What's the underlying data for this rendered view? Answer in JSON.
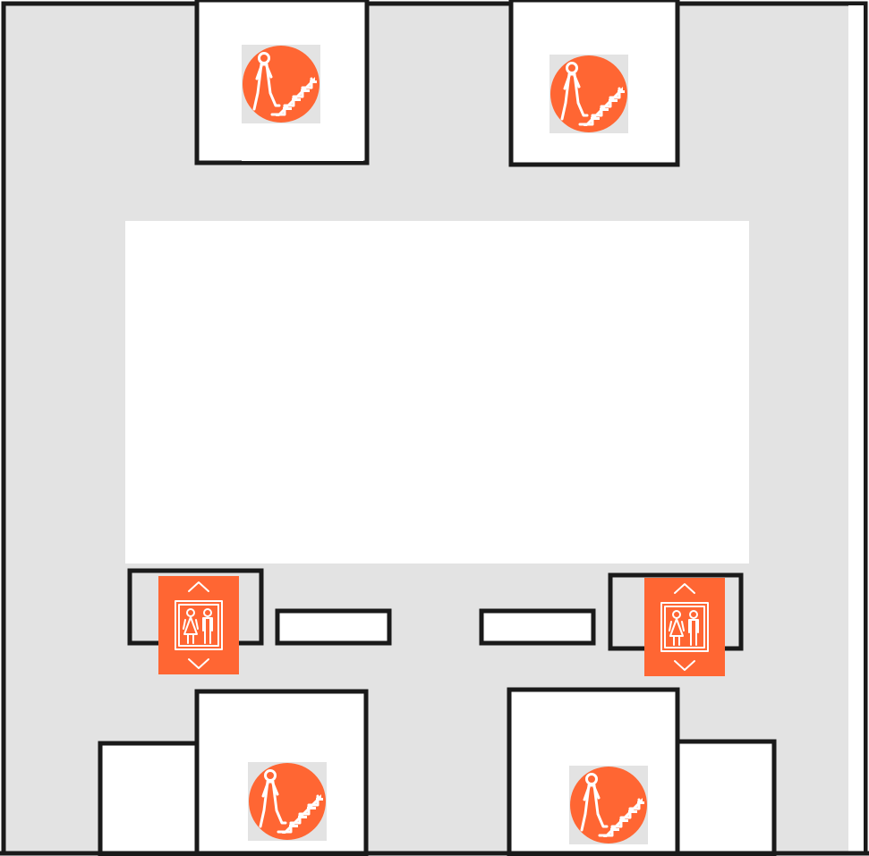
{
  "colors": {
    "floor": "#e3e3e3",
    "wall": "#1a1a1a",
    "room": "#ffffff",
    "sign_background": "#ff6633",
    "sign_symbol": "#ffffff",
    "icon_tile": "#e3e3e3"
  },
  "icons": {
    "stairs": "stairs-down-person-icon",
    "elevator": "elevator-icon"
  }
}
